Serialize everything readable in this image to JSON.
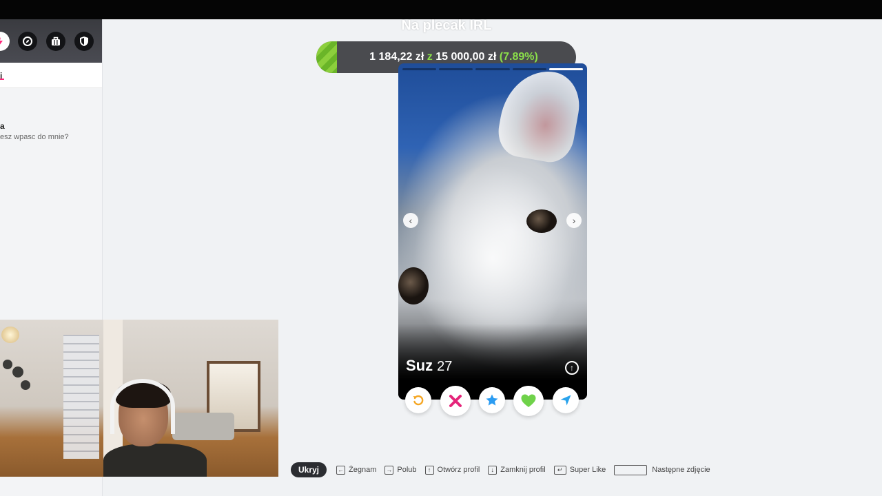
{
  "overlay": {
    "title": "Na plecak IRL",
    "goal_current": "1 184,22 zł",
    "goal_separator": "z",
    "goal_target": "15 000,00 zł",
    "goal_percent": "(7.89%)",
    "goal_fraction": 0.0789
  },
  "sidebar": {
    "header_icons": [
      "bolt-icon",
      "compass-icon",
      "briefcase-icon",
      "shield-icon"
    ],
    "tab_label": "i",
    "message": {
      "name": "a",
      "preview": "esz wpasc do mnie?"
    }
  },
  "card": {
    "photo_count": 5,
    "active_photo": 5,
    "name": "Suz",
    "age": "27",
    "prev_arrow": "‹",
    "next_arrow": "›",
    "info_glyph": "↑"
  },
  "actions": [
    {
      "icon": "rewind-icon",
      "color": "#f5a623"
    },
    {
      "icon": "nope-x-icon",
      "color": "#e5247a"
    },
    {
      "icon": "super-like-star-icon",
      "color": "#2b9cf2"
    },
    {
      "icon": "like-heart-icon",
      "color": "#6fd24a"
    },
    {
      "icon": "boost-send-icon",
      "color": "#2aa3ec"
    }
  ],
  "shortcuts": {
    "hide_label": "Ukryj",
    "nope": "Żegnam",
    "like": "Polub",
    "open_profile": "Otwórz profil",
    "close_profile": "Zamknij profil",
    "super_like": "Super Like",
    "next_photo": "Następne zdjęcie"
  }
}
